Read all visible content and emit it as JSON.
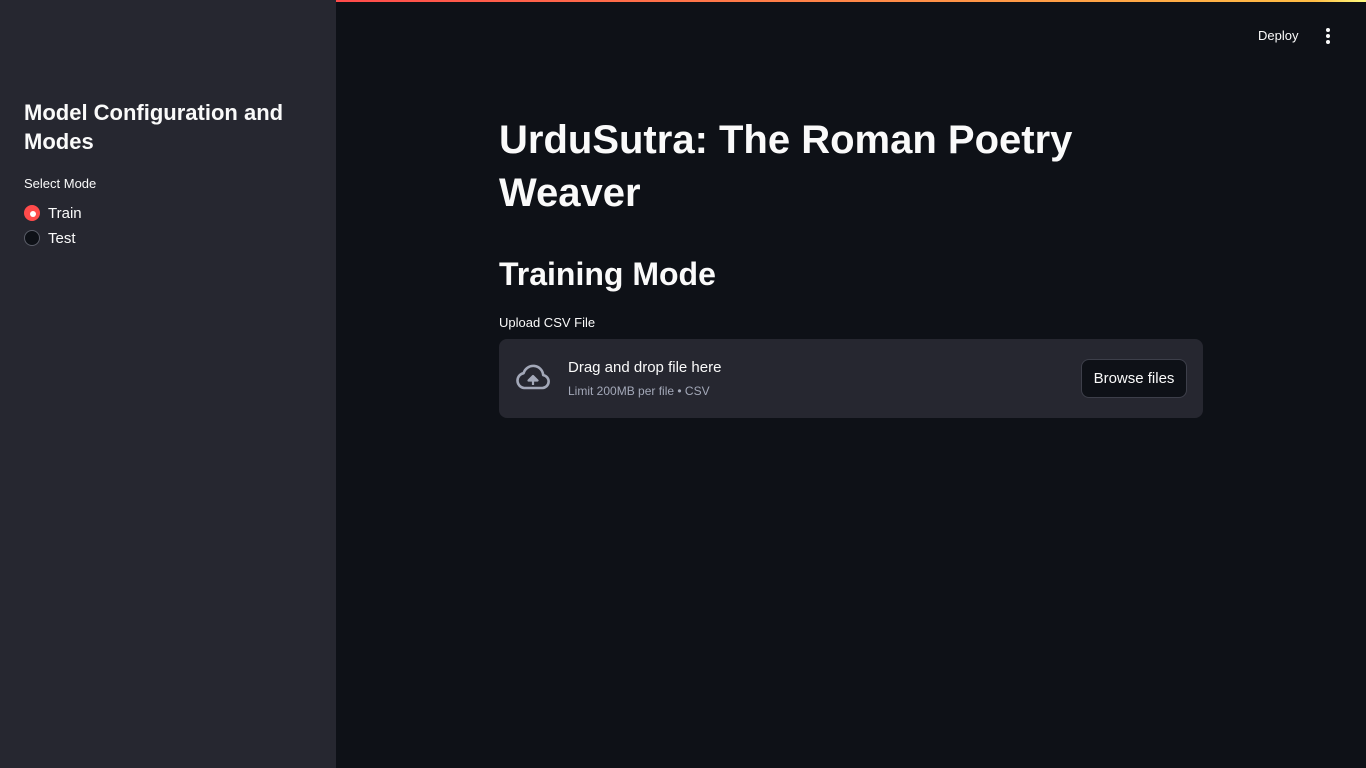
{
  "colors": {
    "background": "#0e1117",
    "sidebar_background": "#262730",
    "primary_accent": "#ff4b4b",
    "text": "#fafafa",
    "muted_text": "#a3a8b8"
  },
  "header": {
    "deploy_label": "Deploy",
    "menu_icon": "vertical-dots-icon"
  },
  "sidebar": {
    "title": "Model Configuration and Modes",
    "radio_group": {
      "label": "Select Mode",
      "options": [
        {
          "label": "Train",
          "selected": true
        },
        {
          "label": "Test",
          "selected": false
        }
      ]
    }
  },
  "main": {
    "title": "UrduSutra: The Roman Poetry Weaver",
    "section_title": "Training Mode",
    "uploader": {
      "label": "Upload CSV File",
      "icon": "cloud-upload-icon",
      "drop_text": "Drag and drop file here",
      "limit_text": "Limit 200MB per file • CSV",
      "browse_label": "Browse files"
    }
  }
}
